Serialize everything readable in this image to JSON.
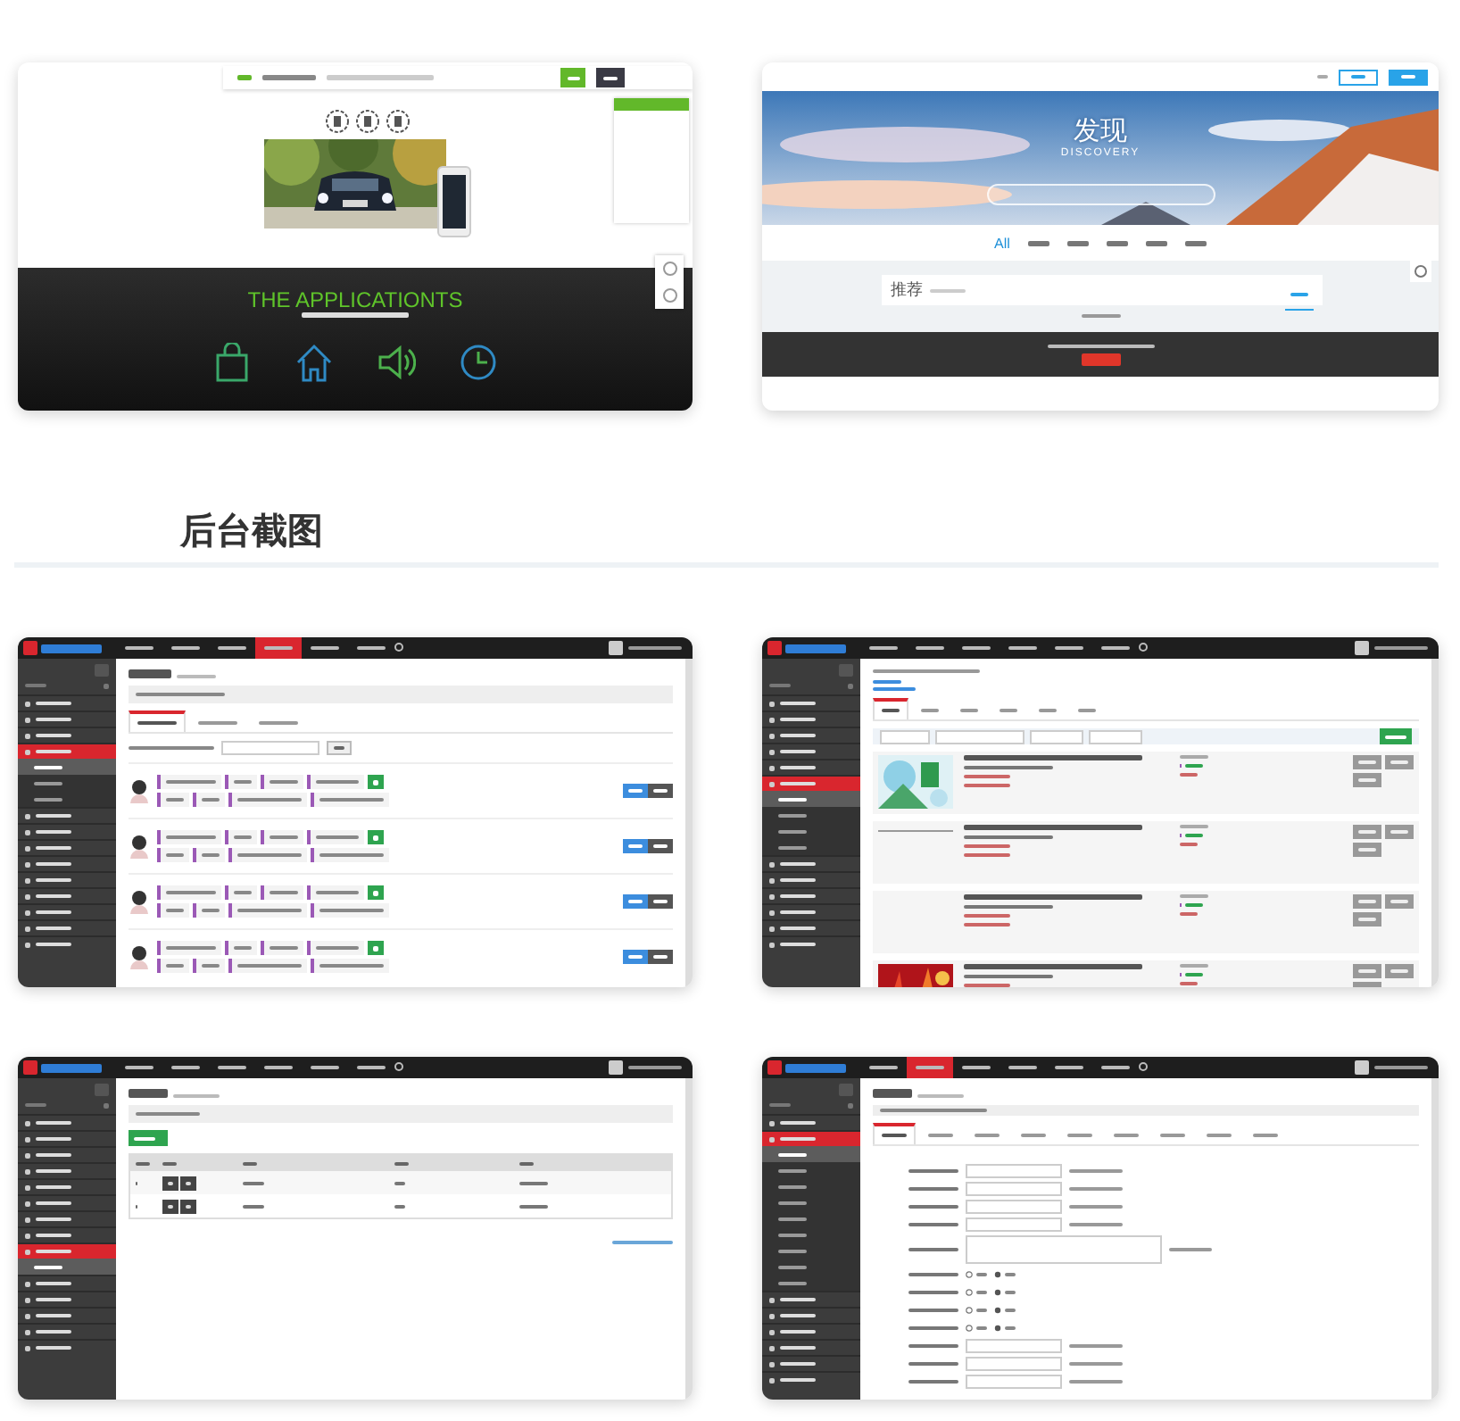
{
  "showcase": [
    {
      "kind": "app-site",
      "headline": "THE APPLICATIONTS"
    },
    {
      "kind": "discovery-site",
      "hero_title": "发现",
      "hero_subtitle": "DISCOVERY",
      "tabs": [
        {
          "label": "All",
          "selected": true
        },
        {
          "selected": false
        },
        {
          "selected": false
        },
        {
          "selected": false
        },
        {
          "selected": false
        },
        {
          "selected": false
        }
      ],
      "card_title": "推荐"
    }
  ],
  "section_heading": "后台截图",
  "admin_screens": [
    {
      "kind": "user-list",
      "top_menu": [
        {
          "selected": false
        },
        {
          "selected": false
        },
        {
          "selected": false
        },
        {
          "selected": true
        },
        {
          "selected": false
        },
        {
          "selected": false
        }
      ],
      "sidebar_items": [
        {
          "kind": "item",
          "selected": false
        },
        {
          "kind": "item",
          "selected": false
        },
        {
          "kind": "item",
          "selected": false
        },
        {
          "kind": "item",
          "selected": true
        },
        {
          "kind": "sub",
          "selected": true
        },
        {
          "kind": "sub",
          "selected": false
        },
        {
          "kind": "sub",
          "selected": false
        },
        {
          "kind": "item",
          "selected": false
        },
        {
          "kind": "item",
          "selected": false
        },
        {
          "kind": "item",
          "selected": false
        },
        {
          "kind": "item",
          "selected": false
        },
        {
          "kind": "item",
          "selected": false
        },
        {
          "kind": "item",
          "selected": false
        },
        {
          "kind": "item",
          "selected": false
        },
        {
          "kind": "item",
          "selected": false
        },
        {
          "kind": "item",
          "selected": false
        }
      ],
      "tabs": [
        {
          "selected": true
        },
        {
          "selected": false
        },
        {
          "selected": false
        }
      ],
      "rows": [
        {
          "kind": "user"
        },
        {
          "kind": "user"
        },
        {
          "kind": "user"
        },
        {
          "kind": "user"
        }
      ]
    },
    {
      "kind": "post-list",
      "top_menu": [
        {
          "selected": false
        },
        {
          "selected": false
        },
        {
          "selected": false
        },
        {
          "selected": false
        },
        {
          "selected": false
        },
        {
          "selected": false
        }
      ],
      "sidebar_items": [
        {
          "kind": "item",
          "selected": false
        },
        {
          "kind": "item",
          "selected": false
        },
        {
          "kind": "item",
          "selected": false
        },
        {
          "kind": "item",
          "selected": false
        },
        {
          "kind": "item",
          "selected": false
        },
        {
          "kind": "item",
          "selected": true
        },
        {
          "kind": "sub",
          "selected": true
        },
        {
          "kind": "sub",
          "selected": false
        },
        {
          "kind": "sub",
          "selected": false
        },
        {
          "kind": "sub",
          "selected": false
        },
        {
          "kind": "item",
          "selected": false
        },
        {
          "kind": "item",
          "selected": false
        },
        {
          "kind": "item",
          "selected": false
        },
        {
          "kind": "item",
          "selected": false
        },
        {
          "kind": "item",
          "selected": false
        },
        {
          "kind": "item",
          "selected": false
        }
      ],
      "tabs": [
        {
          "selected": true
        },
        {
          "selected": false
        },
        {
          "selected": false
        },
        {
          "selected": false
        },
        {
          "selected": false
        },
        {
          "selected": false
        }
      ],
      "rows": [
        {
          "kind": "picture"
        },
        {
          "kind": "line"
        },
        {
          "kind": "plain"
        },
        {
          "kind": "picture"
        }
      ]
    },
    {
      "kind": "table",
      "top_menu": [
        {
          "selected": false
        },
        {
          "selected": false
        },
        {
          "selected": false
        },
        {
          "selected": false
        },
        {
          "selected": false
        },
        {
          "selected": false
        }
      ],
      "sidebar_items": [
        {
          "kind": "item",
          "selected": false
        },
        {
          "kind": "item",
          "selected": false
        },
        {
          "kind": "item",
          "selected": false
        },
        {
          "kind": "item",
          "selected": false
        },
        {
          "kind": "item",
          "selected": false
        },
        {
          "kind": "item",
          "selected": false
        },
        {
          "kind": "item",
          "selected": false
        },
        {
          "kind": "item",
          "selected": false
        },
        {
          "kind": "item",
          "selected": true
        },
        {
          "kind": "sub",
          "selected": true
        },
        {
          "kind": "item",
          "selected": false
        },
        {
          "kind": "item",
          "selected": false
        },
        {
          "kind": "item",
          "selected": false
        },
        {
          "kind": "item",
          "selected": false
        },
        {
          "kind": "item",
          "selected": false
        }
      ],
      "rows": [
        {
          "kind": "row"
        },
        {
          "kind": "row"
        }
      ]
    },
    {
      "kind": "settings-form",
      "top_menu": [
        {
          "selected": false
        },
        {
          "selected": true
        },
        {
          "selected": false
        },
        {
          "selected": false
        },
        {
          "selected": false
        },
        {
          "selected": false
        }
      ],
      "sidebar_items": [
        {
          "kind": "item",
          "selected": false
        },
        {
          "kind": "item",
          "selected": true
        },
        {
          "kind": "sub",
          "selected": true
        },
        {
          "kind": "sub",
          "selected": false
        },
        {
          "kind": "sub",
          "selected": false
        },
        {
          "kind": "sub",
          "selected": false
        },
        {
          "kind": "sub",
          "selected": false
        },
        {
          "kind": "sub",
          "selected": false
        },
        {
          "kind": "sub",
          "selected": false
        },
        {
          "kind": "sub",
          "selected": false
        },
        {
          "kind": "sub",
          "selected": false
        },
        {
          "kind": "item",
          "selected": false
        },
        {
          "kind": "item",
          "selected": false
        },
        {
          "kind": "item",
          "selected": false
        },
        {
          "kind": "item",
          "selected": false
        },
        {
          "kind": "item",
          "selected": false
        },
        {
          "kind": "item",
          "selected": false
        }
      ],
      "tabs": [
        {
          "selected": true
        },
        {
          "selected": false
        },
        {
          "selected": false
        },
        {
          "selected": false
        },
        {
          "selected": false
        },
        {
          "selected": false
        },
        {
          "selected": false
        },
        {
          "selected": false
        },
        {
          "selected": false
        }
      ],
      "rows": [
        {
          "kind": "input"
        },
        {
          "kind": "input"
        },
        {
          "kind": "input"
        },
        {
          "kind": "input"
        },
        {
          "kind": "textarea"
        },
        {
          "kind": "radio"
        },
        {
          "kind": "radio"
        },
        {
          "kind": "radio"
        },
        {
          "kind": "radio"
        },
        {
          "kind": "input"
        },
        {
          "kind": "input"
        },
        {
          "kind": "input"
        }
      ]
    }
  ]
}
